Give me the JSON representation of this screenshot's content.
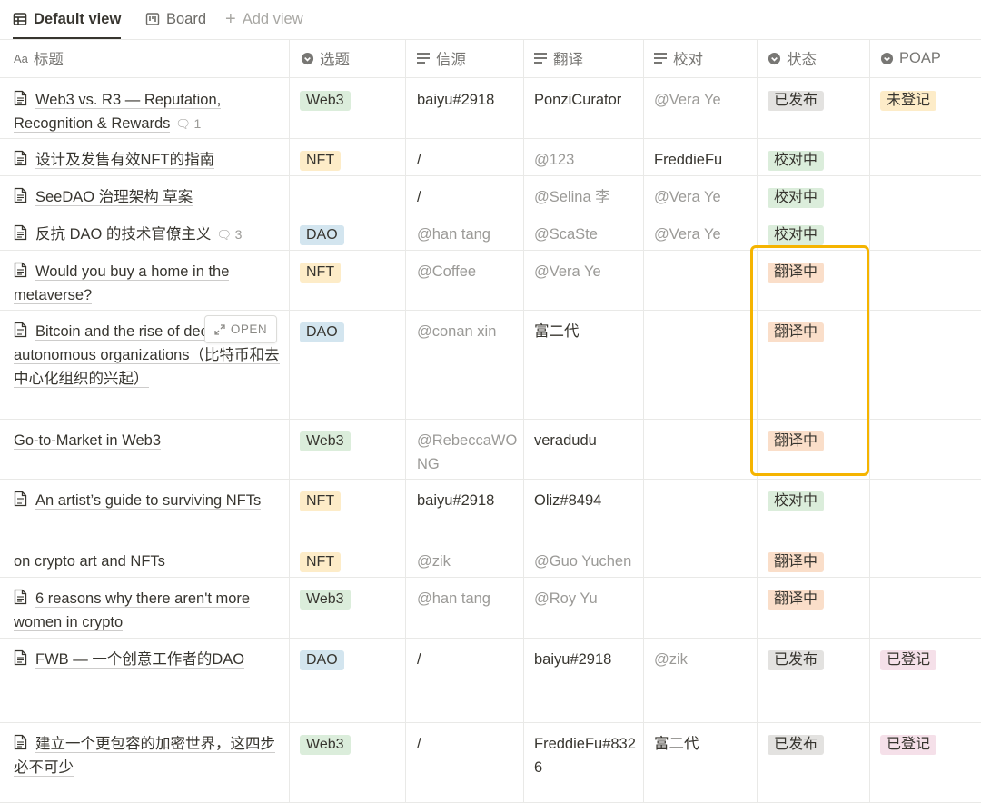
{
  "views": {
    "default": "Default view",
    "board": "Board",
    "add": "Add view"
  },
  "columns": {
    "title": "标题",
    "topic": "选题",
    "source": "信源",
    "translate": "翻译",
    "proofread": "校对",
    "status": "状态",
    "poap": "POAP"
  },
  "hover": {
    "open_label": "OPEN"
  },
  "colors": {
    "tag_web3": "#dbeddb",
    "tag_nft": "#fdecc8",
    "tag_dao": "#d3e5ef",
    "status_published": "#e3e2e0",
    "status_proofing": "#dbeddb",
    "status_translating": "#fadec9",
    "poap_unregistered": "#fdecc8",
    "poap_registered": "#f5e0e9",
    "highlight": "#f5b400"
  },
  "rows": [
    {
      "title": "Web3 vs. R3 — Reputation, Recognition & Rewards",
      "comments": "1",
      "topic": "Web3",
      "source": "baiyu#2918",
      "translate": "PonziCurator",
      "proofread": "@Vera Ye",
      "status": "已发布",
      "poap": "未登记"
    },
    {
      "title": "设计及发售有效NFT的指南",
      "comments": "",
      "topic": "NFT",
      "source": "/",
      "translate": "@123",
      "proofread": "FreddieFu",
      "status": "校对中",
      "poap": ""
    },
    {
      "title": "SeeDAO 治理架构 草案",
      "comments": "",
      "topic": "",
      "source": "/",
      "translate": "@Selina 李",
      "proofread": "@Vera Ye",
      "status": "校对中",
      "poap": ""
    },
    {
      "title": "反抗 DAO 的技术官僚主义",
      "comments": "3",
      "topic": "DAO",
      "source": "@han tang",
      "translate": "@ScaSte",
      "proofread": "@Vera Ye",
      "status": "校对中",
      "poap": ""
    },
    {
      "title": "Would you buy a home in the metaverse?",
      "comments": "",
      "topic": "NFT",
      "source": "@Coffee",
      "translate": "@Vera Ye",
      "proofread": "",
      "status": "翻译中",
      "poap": ""
    },
    {
      "title": "Bitcoin and the rise of decentralized autonomous organizations（比特币和去中心化组织的兴起）",
      "comments": "",
      "topic": "DAO",
      "source": "@conan xin",
      "translate": "富二代",
      "proofread": "",
      "status": "翻译中",
      "poap": ""
    },
    {
      "title": "Go-to-Market in Web3",
      "comments": "",
      "topic": "Web3",
      "source": "@RebeccaWONG",
      "translate": "veradudu",
      "proofread": "",
      "status": "翻译中",
      "poap": ""
    },
    {
      "title": "An artist’s guide to surviving NFTs",
      "comments": "",
      "topic": "NFT",
      "source": "baiyu#2918",
      "translate": "Oliz#8494",
      "proofread": "",
      "status": "校对中",
      "poap": ""
    },
    {
      "title": "on crypto art and NFTs",
      "comments": "",
      "topic": "NFT",
      "source": "@zik",
      "translate": "@Guo Yuchen",
      "proofread": "",
      "status": "翻译中",
      "poap": ""
    },
    {
      "title": "6 reasons why there aren't more women in crypto",
      "comments": "",
      "topic": "Web3",
      "source": "@han tang",
      "translate": "@Roy Yu",
      "proofread": "",
      "status": "翻译中",
      "poap": ""
    },
    {
      "title": "FWB — 一个创意工作者的DAO",
      "comments": "",
      "topic": "DAO",
      "source": "/",
      "translate": "baiyu#2918",
      "proofread": "@zik",
      "status": "已发布",
      "poap": "已登记"
    },
    {
      "title": "建立一个更包容的加密世界，这四步必不可少",
      "comments": "",
      "topic": "Web3",
      "source": "/",
      "translate": "FreddieFu#8326",
      "proofread": "富二代",
      "status": "已发布",
      "poap": "已登记"
    }
  ]
}
